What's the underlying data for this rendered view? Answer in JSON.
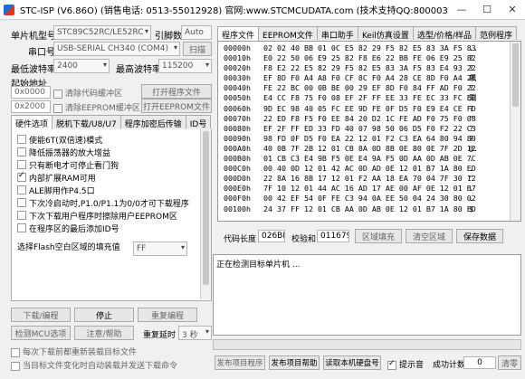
{
  "window": {
    "title": "STC-ISP (V6.86O) (销售电话: 0513-55012928) 官网:www.STCMCUDATA.com  (技术支持QQ:800003751) 本软件...",
    "minimize": "—",
    "maximize": "☐",
    "close": "✕"
  },
  "left": {
    "mcu_label": "单片机型号",
    "mcu_value": "STC89C52RC/LE52RC",
    "pin_label": "引脚数",
    "pin_value": "Auto",
    "port_label": "串口号",
    "port_value": "USB-SERIAL CH340 (COM4)",
    "scan_button": "扫描",
    "min_baud_label": "最低波特率",
    "min_baud": "2400",
    "max_baud_label": "最高波特率",
    "max_baud": "115200",
    "start_addr_label": "起始地址",
    "addr1": "0x0000",
    "clear_code": "清除代码缓冲区",
    "open_program": "打开程序文件",
    "addr2": "0x2000",
    "clear_eeprom": "清除EEPROM缓冲区",
    "open_eeprom": "打开EEPROM文件",
    "tabs": [
      "硬件选项",
      "脱机下载/U8/U7",
      "程序加密后传输",
      "ID号"
    ],
    "options": [
      {
        "label": "使能6T(双倍速)模式",
        "checked": false
      },
      {
        "label": "降低振荡器的放大增益",
        "checked": false
      },
      {
        "label": "只有断电才可停止看门狗",
        "checked": false
      },
      {
        "label": "内部扩展RAM可用",
        "checked": true
      },
      {
        "label": "ALE脚用作P4.5口",
        "checked": false
      },
      {
        "label": "下次冷启动时,P1.0/P1.1为0/0才可下载程序",
        "checked": false
      },
      {
        "label": "下次下载用户程序时擦除用户EEPROM区",
        "checked": false
      },
      {
        "label": "在程序区的最后添加ID号",
        "checked": false
      }
    ],
    "flash_fill_label": "选择Flash空白区域的填充值",
    "flash_fill_value": "FF",
    "download_button": "下载/编程",
    "stop_button": "停止",
    "reprogram_button": "重复编程",
    "check_mcu_button": "检测MCU选项",
    "help_button": "注意/帮助",
    "delay_label": "重复延时",
    "delay_value": "3 秒",
    "reload_label": "每次下载前都重新装载目标文件",
    "auto_label": "当目标文件变化时自动装载并发送下载命令"
  },
  "right": {
    "tabs": [
      "程序文件",
      "EEPROM文件",
      "串口助手",
      "Keil仿真设置",
      "选型/价格/样品",
      "范例程序"
    ],
    "hex_rows": [
      {
        "addr": "00000h",
        "bytes": "02 02 40 BB 01 0C E5 82 29 F5 82 E5 83 3A F5 83",
        "ascii": ".."
      },
      {
        "addr": "00010h",
        "bytes": "E0 22 50 06 E9 25 82 F8 E6 22 BB FE 06 E9 25 82",
        "ascii": "?"
      },
      {
        "addr": "00020h",
        "bytes": "F8 E2 22 E5 82 29 F5 82 E5 83 3A F5 83 E4 93 22",
        "ascii": "?"
      },
      {
        "addr": "00030h",
        "bytes": "EF 8D F0 A4 A8 F0 CF 8C F0 A4 28 CE 8D F0 A4 2E",
        "ascii": "飙"
      },
      {
        "addr": "00040h",
        "bytes": "FE 22 BC 00 0B BE 00 29 EF 8D F0 84 FF AD F0 22",
        "ascii": "?"
      },
      {
        "addr": "00050h",
        "bytes": "E4 CC F8 75 F0 08 EF 2F FF EE 33 FE EC 33 FC EE",
        "ascii": "涮"
      },
      {
        "addr": "00060h",
        "bytes": "9D EC 98 40 05 FC EE 9D FE 0F D5 F0 E9 E4 CE FD",
        "ascii": "?"
      },
      {
        "addr": "00070h",
        "bytes": "22 ED F8 F5 F0 EE 84 20 D2 1C FE AD F0 75 F0 08",
        "ascii": "\""
      },
      {
        "addr": "00080h",
        "bytes": "EF 2F FF ED 33 FD 40 07 98 50 06 D5 F0 F2 22 C3",
        "ascii": "?"
      },
      {
        "addr": "00090h",
        "bytes": "98 FD 0F D5 F0 EA 22 12 01 F2 C3 EA 64 80 94 80",
        "ascii": "?"
      },
      {
        "addr": "000A0h",
        "bytes": "40 0B 7F 2B 12 01 CB 8A 0D 8B 0E 80 0E 7F 2D 12",
        "ascii": "@."
      },
      {
        "addr": "000B0h",
        "bytes": "01 CB C3 E4 9B F5 0E E4 9A F5 0D AA 0D AB 0E 7C",
        "ascii": "."
      },
      {
        "addr": "000C0h",
        "bytes": "00 40 0D 12 01 42 AC 0D AD 0E 12 01 B7 1A 80 ED",
        "ascii": "."
      },
      {
        "addr": "000D0h",
        "bytes": "22 8A 16 8B 17 12 01 F2 AA 18 EA 70 04 7F 30 12",
        "ascii": "\""
      },
      {
        "addr": "000E0h",
        "bytes": "7F 10 12 01 44 AC 16 AD 17 AE 00 AF 0E 12 01 B7",
        "ascii": "."
      },
      {
        "addr": "000F0h",
        "bytes": "00 42 EF 54 0F FE C3 94 0A EE 50 04 24 30 80 02",
        "ascii": "."
      },
      {
        "addr": "00100h",
        "bytes": "24 37 FF 12 01 CB AA 0D AB 0E 12 01 B7 1A 80 ED",
        "ascii": "$"
      }
    ],
    "code_len_label": "代码长度",
    "code_len": "026BH",
    "checksum_label": "校验和",
    "checksum": "011679H",
    "fill_button": "区域填充",
    "clear_button": "清空区域",
    "save_button": "保存数据",
    "log_text": "正在检测目标单片机 ...",
    "publish_button": "发布项目程序",
    "publish_help_button": "发布项目帮助",
    "read_serial_button": "读取本机硬盘号",
    "tone_label": "提示音",
    "success_label": "成功计数",
    "success_count": "0",
    "clear_count_button": "清零"
  }
}
